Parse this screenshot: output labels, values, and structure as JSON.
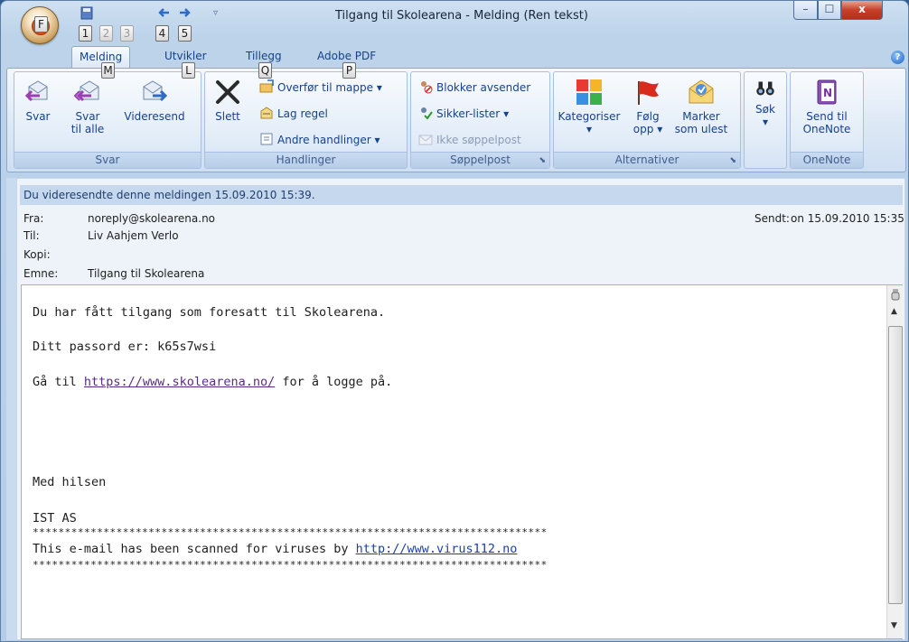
{
  "window": {
    "title": "Tilgang til Skolearena - Melding (Ren tekst)",
    "min_label": "–",
    "max_label": "☐",
    "close_label": "x"
  },
  "office_button": {
    "keytip": "F"
  },
  "quick_access": {
    "keytips": [
      "1",
      "2",
      "3",
      "4",
      "5"
    ],
    "customize_label": "▿"
  },
  "tabs": [
    {
      "label": "Melding",
      "keytip": "M",
      "active": true
    },
    {
      "label": "Utvikler",
      "keytip": "L"
    },
    {
      "label": "Tillegg",
      "keytip": "Q"
    },
    {
      "label": "Adobe PDF",
      "keytip": "P"
    }
  ],
  "help_label": "?",
  "ribbon": {
    "svar": {
      "label": "Svar",
      "reply": "Svar",
      "reply_all_line1": "Svar",
      "reply_all_line2": "til alle",
      "forward": "Videresend"
    },
    "handlinger": {
      "label": "Handlinger",
      "delete": "Slett",
      "move": "Overfør til mappe",
      "rule": "Lag regel",
      "other": "Andre handlinger"
    },
    "soppelpost": {
      "label": "Søppelpost",
      "block": "Blokker avsender",
      "safe": "Sikker-lister",
      "notjunk": "Ikke søppelpost"
    },
    "alternativer": {
      "label": "Alternativer",
      "categorize": "Kategoriser",
      "follow_line1": "Følg",
      "follow_line2": "opp",
      "mark_line1": "Marker",
      "mark_line2": "som ulest"
    },
    "search": {
      "label": "Søk"
    },
    "onenote": {
      "label": "OneNote",
      "send_line1": "Send til",
      "send_line2": "OneNote"
    }
  },
  "message": {
    "info": "Du videresendte denne meldingen 15.09.2010 15:39.",
    "from_label": "Fra:",
    "from": "noreply@skolearena.no",
    "to_label": "Til:",
    "to": "Liv Aahjem Verlo",
    "cc_label": "Kopi:",
    "cc": "",
    "subject_label": "Emne:",
    "subject": "Tilgang til Skolearena",
    "sent_label": "Sendt:",
    "sent": "on 15.09.2010 15:35",
    "body": {
      "line1": "Du har fått tilgang som foresatt til Skolearena.",
      "line2": "Ditt passord er: k65s7wsi",
      "line3_prefix": "Gå til ",
      "line3_link": "https://www.skolearena.no/",
      "line3_suffix": " for å logge på.",
      "greeting": "Med hilsen",
      "company": "IST AS",
      "stars": "********************************************************************************",
      "scan_prefix": "This e-mail has been scanned for viruses by ",
      "scan_link": "http://www.virus112.no",
      "stars2": "********************************************************************************"
    }
  }
}
